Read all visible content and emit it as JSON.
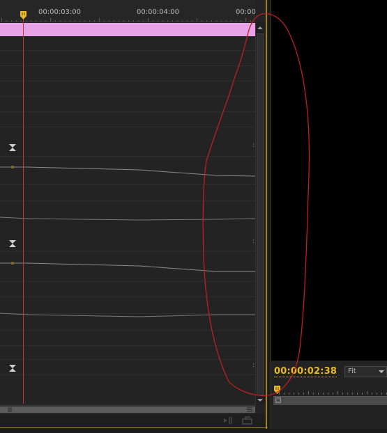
{
  "timeline": {
    "ruler_labels": [
      "00:00:03:00",
      "00:00:04:00",
      "00:00"
    ]
  },
  "monitor": {
    "timecode": "00:00:02:38",
    "zoom_select": {
      "selected": "Fit"
    }
  },
  "icons": {
    "playhead": "playhead-marker-icon",
    "keyframe_nav": "keyframe-nav-icon",
    "keyframe": "keyframe-dot-icon",
    "scroll_up": "arrow-up-icon",
    "scroll_down": "arrow-down-icon",
    "insert": "insert-icon",
    "export_frame": "export-frame-icon",
    "dropdown": "chevron-down-icon"
  },
  "colors": {
    "clip": "#e8a3e8",
    "playhead": "#c8342b",
    "timecode": "#e8b92a",
    "panel_border": "#a07f2a",
    "annotation": "#c02020"
  }
}
